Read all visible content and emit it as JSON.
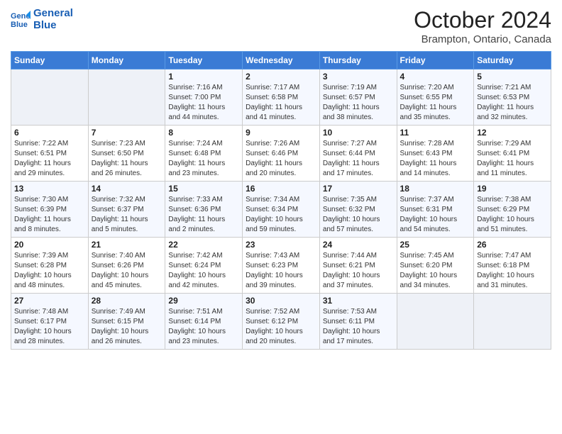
{
  "logo": {
    "line1": "General",
    "line2": "Blue"
  },
  "title": "October 2024",
  "location": "Brampton, Ontario, Canada",
  "weekdays": [
    "Sunday",
    "Monday",
    "Tuesday",
    "Wednesday",
    "Thursday",
    "Friday",
    "Saturday"
  ],
  "weeks": [
    [
      {
        "day": "",
        "info": ""
      },
      {
        "day": "",
        "info": ""
      },
      {
        "day": "1",
        "info": "Sunrise: 7:16 AM\nSunset: 7:00 PM\nDaylight: 11 hours\nand 44 minutes."
      },
      {
        "day": "2",
        "info": "Sunrise: 7:17 AM\nSunset: 6:58 PM\nDaylight: 11 hours\nand 41 minutes."
      },
      {
        "day": "3",
        "info": "Sunrise: 7:19 AM\nSunset: 6:57 PM\nDaylight: 11 hours\nand 38 minutes."
      },
      {
        "day": "4",
        "info": "Sunrise: 7:20 AM\nSunset: 6:55 PM\nDaylight: 11 hours\nand 35 minutes."
      },
      {
        "day": "5",
        "info": "Sunrise: 7:21 AM\nSunset: 6:53 PM\nDaylight: 11 hours\nand 32 minutes."
      }
    ],
    [
      {
        "day": "6",
        "info": "Sunrise: 7:22 AM\nSunset: 6:51 PM\nDaylight: 11 hours\nand 29 minutes."
      },
      {
        "day": "7",
        "info": "Sunrise: 7:23 AM\nSunset: 6:50 PM\nDaylight: 11 hours\nand 26 minutes."
      },
      {
        "day": "8",
        "info": "Sunrise: 7:24 AM\nSunset: 6:48 PM\nDaylight: 11 hours\nand 23 minutes."
      },
      {
        "day": "9",
        "info": "Sunrise: 7:26 AM\nSunset: 6:46 PM\nDaylight: 11 hours\nand 20 minutes."
      },
      {
        "day": "10",
        "info": "Sunrise: 7:27 AM\nSunset: 6:44 PM\nDaylight: 11 hours\nand 17 minutes."
      },
      {
        "day": "11",
        "info": "Sunrise: 7:28 AM\nSunset: 6:43 PM\nDaylight: 11 hours\nand 14 minutes."
      },
      {
        "day": "12",
        "info": "Sunrise: 7:29 AM\nSunset: 6:41 PM\nDaylight: 11 hours\nand 11 minutes."
      }
    ],
    [
      {
        "day": "13",
        "info": "Sunrise: 7:30 AM\nSunset: 6:39 PM\nDaylight: 11 hours\nand 8 minutes."
      },
      {
        "day": "14",
        "info": "Sunrise: 7:32 AM\nSunset: 6:37 PM\nDaylight: 11 hours\nand 5 minutes."
      },
      {
        "day": "15",
        "info": "Sunrise: 7:33 AM\nSunset: 6:36 PM\nDaylight: 11 hours\nand 2 minutes."
      },
      {
        "day": "16",
        "info": "Sunrise: 7:34 AM\nSunset: 6:34 PM\nDaylight: 10 hours\nand 59 minutes."
      },
      {
        "day": "17",
        "info": "Sunrise: 7:35 AM\nSunset: 6:32 PM\nDaylight: 10 hours\nand 57 minutes."
      },
      {
        "day": "18",
        "info": "Sunrise: 7:37 AM\nSunset: 6:31 PM\nDaylight: 10 hours\nand 54 minutes."
      },
      {
        "day": "19",
        "info": "Sunrise: 7:38 AM\nSunset: 6:29 PM\nDaylight: 10 hours\nand 51 minutes."
      }
    ],
    [
      {
        "day": "20",
        "info": "Sunrise: 7:39 AM\nSunset: 6:28 PM\nDaylight: 10 hours\nand 48 minutes."
      },
      {
        "day": "21",
        "info": "Sunrise: 7:40 AM\nSunset: 6:26 PM\nDaylight: 10 hours\nand 45 minutes."
      },
      {
        "day": "22",
        "info": "Sunrise: 7:42 AM\nSunset: 6:24 PM\nDaylight: 10 hours\nand 42 minutes."
      },
      {
        "day": "23",
        "info": "Sunrise: 7:43 AM\nSunset: 6:23 PM\nDaylight: 10 hours\nand 39 minutes."
      },
      {
        "day": "24",
        "info": "Sunrise: 7:44 AM\nSunset: 6:21 PM\nDaylight: 10 hours\nand 37 minutes."
      },
      {
        "day": "25",
        "info": "Sunrise: 7:45 AM\nSunset: 6:20 PM\nDaylight: 10 hours\nand 34 minutes."
      },
      {
        "day": "26",
        "info": "Sunrise: 7:47 AM\nSunset: 6:18 PM\nDaylight: 10 hours\nand 31 minutes."
      }
    ],
    [
      {
        "day": "27",
        "info": "Sunrise: 7:48 AM\nSunset: 6:17 PM\nDaylight: 10 hours\nand 28 minutes."
      },
      {
        "day": "28",
        "info": "Sunrise: 7:49 AM\nSunset: 6:15 PM\nDaylight: 10 hours\nand 26 minutes."
      },
      {
        "day": "29",
        "info": "Sunrise: 7:51 AM\nSunset: 6:14 PM\nDaylight: 10 hours\nand 23 minutes."
      },
      {
        "day": "30",
        "info": "Sunrise: 7:52 AM\nSunset: 6:12 PM\nDaylight: 10 hours\nand 20 minutes."
      },
      {
        "day": "31",
        "info": "Sunrise: 7:53 AM\nSunset: 6:11 PM\nDaylight: 10 hours\nand 17 minutes."
      },
      {
        "day": "",
        "info": ""
      },
      {
        "day": "",
        "info": ""
      }
    ]
  ]
}
